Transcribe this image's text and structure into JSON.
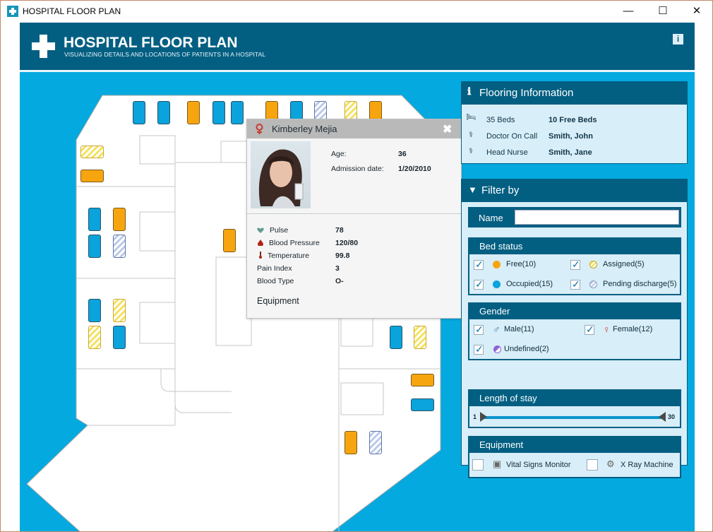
{
  "window": {
    "title": "HOSPITAL FLOOR PLAN",
    "minimize": "—",
    "maximize": "☐",
    "close": "✕"
  },
  "header": {
    "title": "HOSPITAL FLOOR PLAN",
    "subtitle": "VISUALIZING DETAILS AND LOCATIONS OF PATIENTS IN A HOSPITAL",
    "info": "i"
  },
  "popup": {
    "name": "Kimberley Mejia",
    "close": "✖",
    "age_label": "Age:",
    "age": "36",
    "admission_label": "Admission date:",
    "admission": "1/20/2010",
    "vitals": [
      {
        "label": "Pulse",
        "value": "78",
        "icon": "heart-icon"
      },
      {
        "label": "Blood Pressure",
        "value": "120/80",
        "icon": "drop-icon"
      },
      {
        "label": "Temperature",
        "value": "99.8",
        "icon": "thermometer-icon"
      },
      {
        "label": "Pain Index",
        "value": "3"
      },
      {
        "label": "Blood Type",
        "value": "O-"
      }
    ],
    "equipment_label": "Equipment"
  },
  "flooring": {
    "title": "Flooring Information",
    "rows": [
      {
        "label": "35 Beds",
        "value": "10 Free Beds",
        "icon": "bed-icon"
      },
      {
        "label": "Doctor On Call",
        "value": "Smith, John",
        "icon": "doctor-icon"
      },
      {
        "label": "Head Nurse",
        "value": "Smith, Jane",
        "icon": "nurse-icon"
      }
    ]
  },
  "filter": {
    "title": "Filter by",
    "name_label": "Name",
    "name_value": "",
    "bed_status": {
      "title": "Bed status",
      "free": "Free(10)",
      "assigned": "Assigned(5)",
      "occupied": "Occupied(15)",
      "pending": "Pending discharge(5)"
    },
    "gender": {
      "title": "Gender",
      "male": "Male(11)",
      "female": "Female(12)",
      "undefined": "Undefined(2)"
    },
    "stay": {
      "title": "Length of stay",
      "min": "1",
      "max": "30",
      "start_fraction": 0,
      "end_fraction": 1
    },
    "equipment": {
      "title": "Equipment",
      "vital": "Vital Signs Monitor",
      "xray": "X Ray Machine"
    }
  },
  "colors": {
    "header": "#035f82",
    "background": "#04a9df",
    "free": "#f7a50f",
    "occupied": "#0aa3db",
    "assigned": "#f4e159",
    "pending": "#b8c8e8"
  }
}
